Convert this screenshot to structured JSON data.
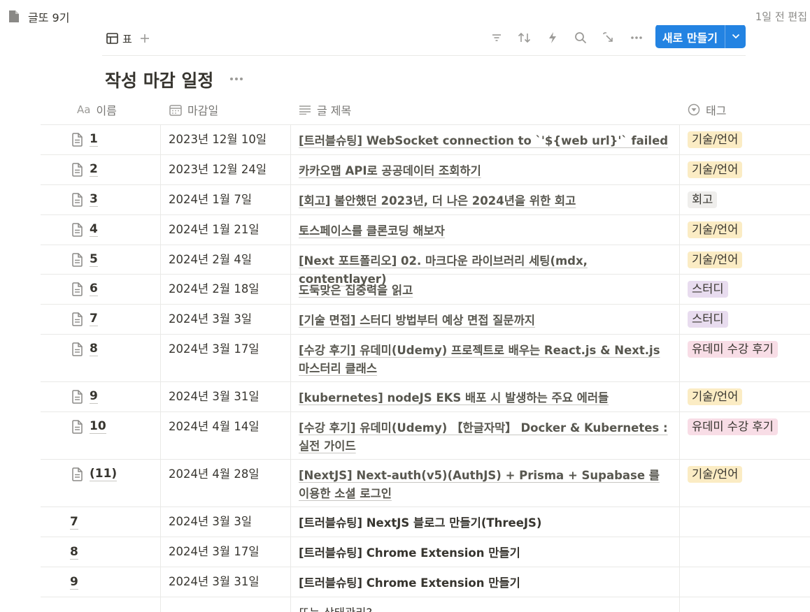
{
  "topbar": {
    "page_title": "글또 9기",
    "edited": "1일 전 편집"
  },
  "toolbar": {
    "view_label": "표",
    "new_button": "새로 만들기"
  },
  "database": {
    "title": "작성 마감 일정"
  },
  "columns": [
    {
      "label": "이름",
      "icon": "text-icon",
      "icon_glyph": "Aa"
    },
    {
      "label": "마감일",
      "icon": "calendar-icon"
    },
    {
      "label": "글 제목",
      "icon": "lines-icon"
    },
    {
      "label": "태그",
      "icon": "select-icon"
    }
  ],
  "rows": [
    {
      "name": "1",
      "date": "2023년 12월 10일",
      "title": "[트러블슈팅] WebSocket connection to `'${web url}'` failed",
      "tag": "기술/언어",
      "tag_color": "#fbecc4"
    },
    {
      "name": "2",
      "date": "2023년 12월 24일",
      "title": "카카오맵 API로 공공데이터 조회하기",
      "tag": "기술/언어",
      "tag_color": "#fbecc4"
    },
    {
      "name": "3",
      "date": "2024년 1월 7일",
      "title": "[회고] 불안했던 2023년, 더 나은 2024년을 위한 회고",
      "tag": "회고",
      "tag_color": "#efeeec"
    },
    {
      "name": "4",
      "date": "2024년 1월 21일",
      "title": "토스페이스를 클론코딩 해보자",
      "tag": "기술/언어",
      "tag_color": "#fbecc4"
    },
    {
      "name": "5",
      "date": "2024년 2월 4일",
      "title": "[Next 포트폴리오] 02. 마크다운 라이브러리 세팅(mdx, contentlayer)",
      "tag": "기술/언어",
      "tag_color": "#fbecc4"
    },
    {
      "name": "6",
      "date": "2024년 2월 18일",
      "title": "도둑맞은 집중력을 읽고",
      "tag": "스터디",
      "tag_color": "#e8dcef"
    },
    {
      "name": "7",
      "date": "2024년 3월 3일",
      "title": "[기술 면접] 스터디 방법부터 예상 면접 질문까지",
      "tag": "스터디",
      "tag_color": "#e8dcef"
    },
    {
      "name": "8",
      "date": "2024년 3월 17일",
      "title": "[수강 후기] 유데미(Udemy) 프로젝트로 배우는 React.js & Next.js 마스터리 클래스",
      "tag": "유데미 수강 후기",
      "tag_color": "#f8dde6"
    },
    {
      "name": "9",
      "date": "2024년 3월 31일",
      "title": "[kubernetes] nodeJS EKS 배포 시 발생하는 주요 에러들",
      "tag": "기술/언어",
      "tag_color": "#fbecc4"
    },
    {
      "name": "10",
      "date": "2024년 4월 14일",
      "title": "[수강 후기] 유데미(Udemy) 【한글자막】 Docker & Kubernetes : 실전 가이드",
      "tag": "유데미 수강 후기",
      "tag_color": "#f8dde6"
    },
    {
      "name": "(11)",
      "date": "2024년 4월 28일",
      "title": "[NextJS] Next-auth(v5)(AuthJS) + Prisma + Supabase 를 이용한 소셜 로그인",
      "tag": "기술/언어",
      "tag_color": "#fbecc4"
    },
    {
      "name": "7",
      "date": "2024년 3월 3일",
      "title": "[트러블슈팅] NextJS 블로그 만들기(ThreeJS)",
      "tag": ""
    },
    {
      "name": "8",
      "date": "2024년 3월 17일",
      "title": "[트러블슈팅] Chrome Extension 만들기",
      "tag": ""
    },
    {
      "name": "9",
      "date": "2024년 3월 31일",
      "title": "[트러블슈팅] Chrome Extension 만들기",
      "tag": ""
    },
    {
      "name": "",
      "date": "",
      "title": "또는 상태관리?",
      "tag": ""
    }
  ],
  "colors": {
    "accent": "#2383e2",
    "text": "#37352f",
    "muted": "#787774",
    "border": "#e9e9e7"
  }
}
